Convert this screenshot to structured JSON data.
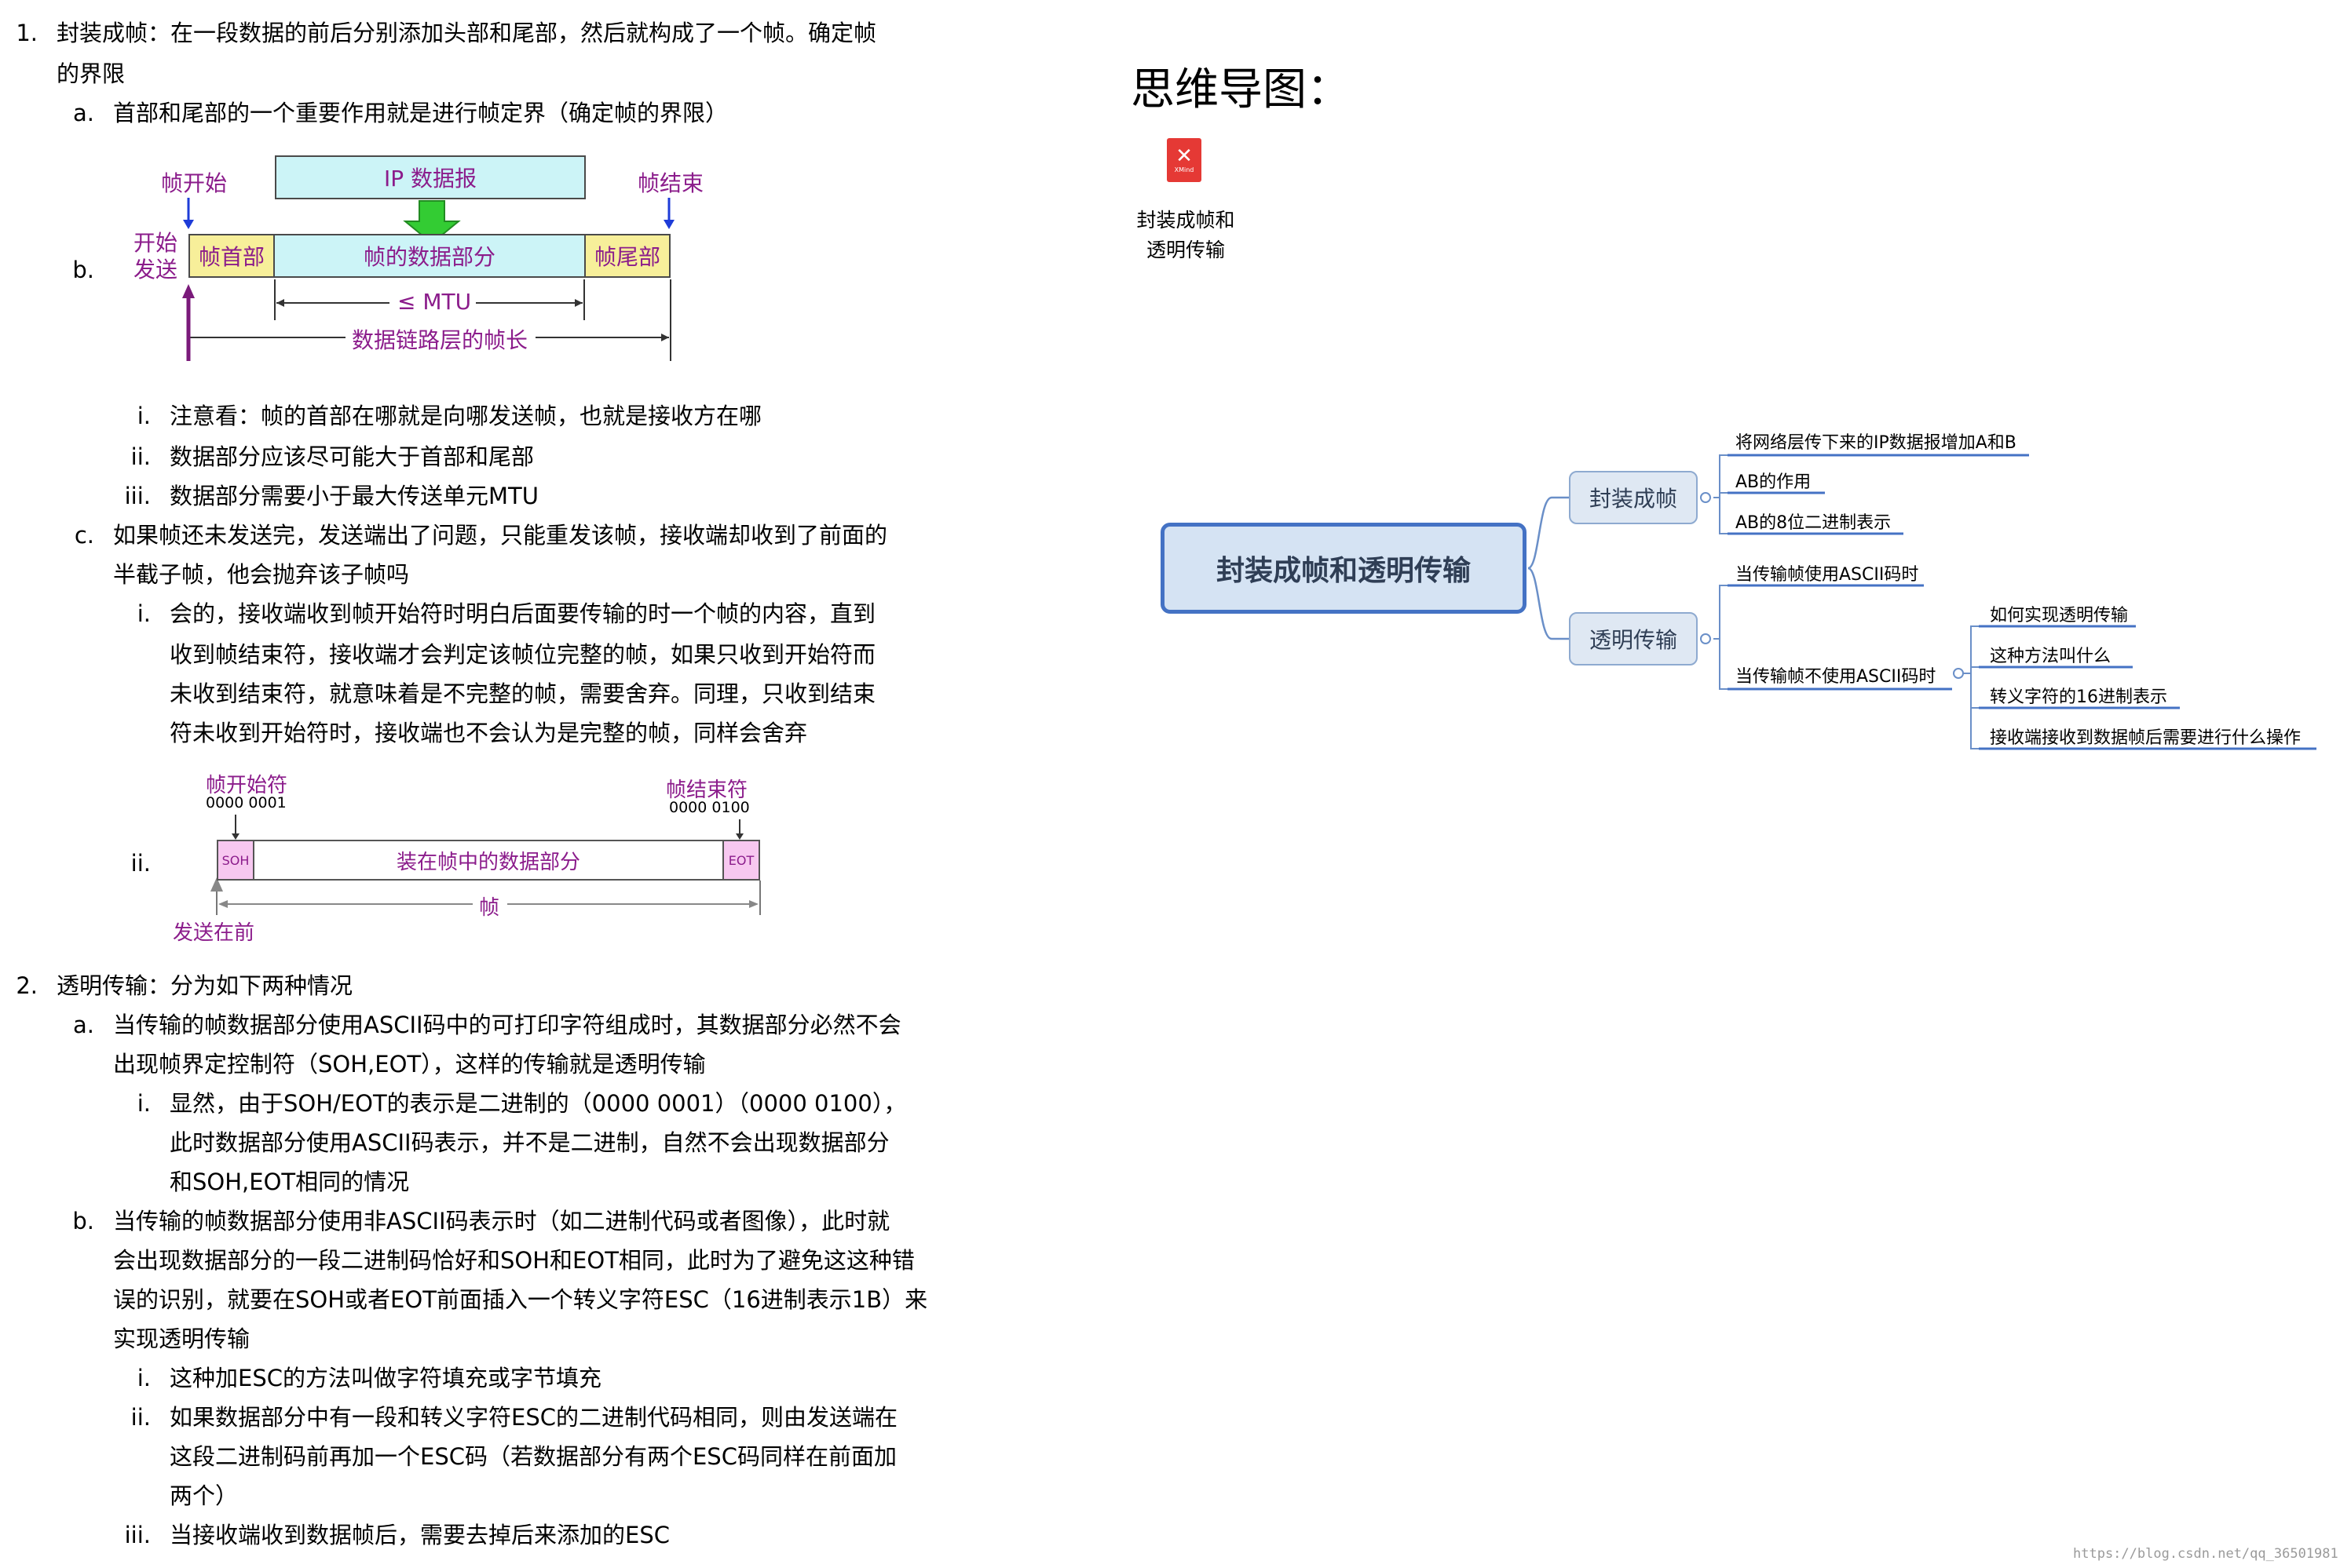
{
  "doc": {
    "s1": {
      "num": "1.",
      "l1": "封装成帧：在一段数据的前后分别添加头部和尾部，然后就构成了一个帧。确定帧",
      "l2": "的界限"
    },
    "s1a": {
      "num": "a.",
      "text": "首部和尾部的一个重要作用就是进行帧定界（确定帧的界限）"
    },
    "s1b": {
      "num": "b."
    },
    "s1b_i": {
      "num": "i.",
      "text": "注意看：帧的首部在哪就是向哪发送帧，也就是接收方在哪"
    },
    "s1b_ii": {
      "num": "ii.",
      "text": "数据部分应该尽可能大于首部和尾部"
    },
    "s1b_iii": {
      "num": "iii.",
      "text": "数据部分需要小于最大传送单元MTU"
    },
    "s1c": {
      "num": "c.",
      "l1": "如果帧还未发送完，发送端出了问题，只能重发该帧，接收端却收到了前面的",
      "l2": "半截子帧，他会抛弃该子帧吗"
    },
    "s1c_i": {
      "num": "i.",
      "l1": "会的，接收端收到帧开始符时明白后面要传输的时一个帧的内容，直到",
      "l2": "收到帧结束符，接收端才会判定该帧位完整的帧，如果只收到开始符而",
      "l3": "未收到结束符，就意味着是不完整的帧，需要舍弃。同理，只收到结束",
      "l4": "符未收到开始符时，接收端也不会认为是完整的帧，同样会舍弃"
    },
    "s1c_ii": {
      "num": "ii."
    },
    "s2": {
      "num": "2.",
      "text": "透明传输：分为如下两种情况"
    },
    "s2a": {
      "num": "a.",
      "l1": "当传输的帧数据部分使用ASCII码中的可打印字符组成时，其数据部分必然不会",
      "l2": "出现帧界定控制符（SOH,EOT），这样的传输就是透明传输"
    },
    "s2a_i": {
      "num": "i.",
      "l1": "显然，由于SOH/EOT的表示是二进制的（0000 0001）（0000 0100），",
      "l2": "此时数据部分使用ASCII码表示，并不是二进制，自然不会出现数据部分",
      "l3": "和SOH,EOT相同的情况"
    },
    "s2b": {
      "num": "b.",
      "l1": "当传输的帧数据部分使用非ASCII码表示时（如二进制代码或者图像），此时就",
      "l2": "会出现数据部分的一段二进制码恰好和SOH和EOT相同，此时为了避免这这种错",
      "l3": "误的识别，就要在SOH或者EOT前面插入一个转义字符ESC（16进制表示1B）来",
      "l4": "实现透明传输"
    },
    "s2b_i": {
      "num": "i.",
      "text": "这种加ESC的方法叫做字符填充或字节填充"
    },
    "s2b_ii": {
      "num": "ii.",
      "l1": "如果数据部分中有一段和转义字符ESC的二进制代码相同，则由发送端在",
      "l2": "这段二进制码前再加一个ESC码（若数据部分有两个ESC码同样在前面加",
      "l3": "两个）"
    },
    "s2b_iii": {
      "num": "iii.",
      "text": "当接收端收到数据帧后，需要去掉后来添加的ESC"
    }
  },
  "diagram1": {
    "frame_start": "帧开始",
    "frame_end": "帧结束",
    "ip_packet": "IP 数据报",
    "start_send_1": "开始",
    "start_send_2": "发送",
    "header": "帧首部",
    "data": "帧的数据部分",
    "trailer": "帧尾部",
    "mtu": "≤ MTU",
    "frame_len": "数据链路层的帧长"
  },
  "diagram2": {
    "start_char": "帧开始符",
    "start_code": "0000 0001",
    "end_char": "帧结束符",
    "end_code": "0000 0100",
    "soh": "SOH",
    "eot": "EOT",
    "data": "装在帧中的数据部分",
    "frame": "帧",
    "send_first": "发送在前"
  },
  "mindmap": {
    "heading": "思维导图：",
    "file_icon_label": "XMind",
    "file_label_1": "封装成帧和",
    "file_label_2": "透明传输",
    "root": "封装成帧和透明传输",
    "branch1": "封装成帧",
    "branch1_leaves": [
      "将网络层传下来的IP数据报增加A和B",
      "AB的作用",
      "AB的8位二进制表示"
    ],
    "branch2": "透明传输",
    "branch2_leaf1": "当传输帧使用ASCII码时",
    "branch2_leaf2": "当传输帧不使用ASCII码时",
    "branch2_sub": [
      "如何实现透明传输",
      "这种方法叫什么",
      "转义字符的16进制表示",
      "接收端接收到数据帧后需要进行什么操作"
    ],
    "colors": {
      "root_fill": "#d5e3f3",
      "root_border": "#4472c4",
      "branch_fill": "#dfe8f3",
      "branch_border": "#8eaad0",
      "underline": "#4472c4",
      "connector": "#6a8fc8"
    }
  },
  "watermark": "https://blog.csdn.net/qq_36501981"
}
